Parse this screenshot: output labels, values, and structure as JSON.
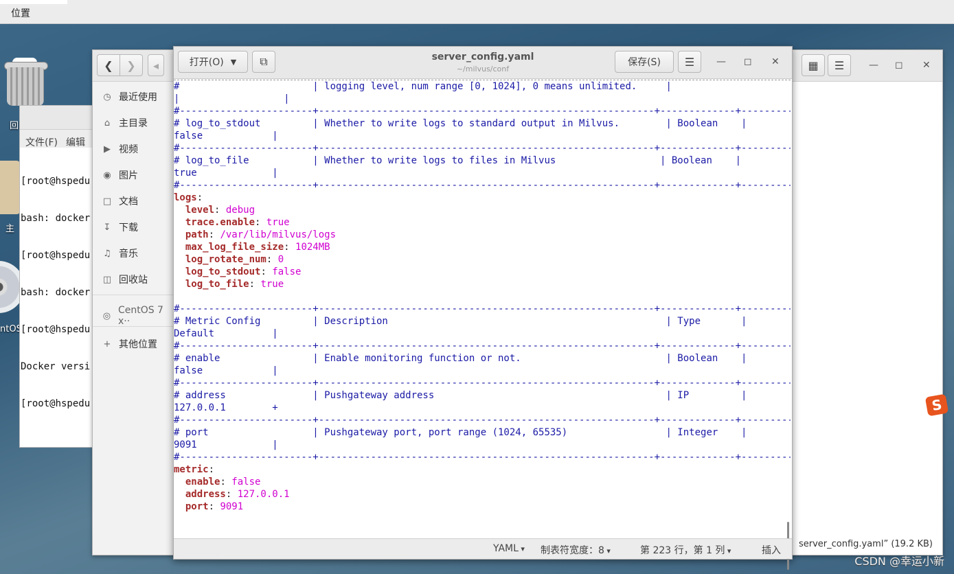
{
  "topbar": {
    "location_label": "位置"
  },
  "desktop": {
    "trash_label": "回",
    "home_label": "主",
    "disc_label": "ntOS"
  },
  "terminal": {
    "menu": [
      "文件(F)",
      "编辑"
    ],
    "lines": [
      "[root@hspedu",
      "bash: docker",
      "[root@hspedu",
      "bash: docker",
      "[root@hspedu",
      "Docker versi",
      "[root@hspedu"
    ]
  },
  "file_manager": {
    "sidebar": [
      {
        "label": "最近使用",
        "icon": "clock-icon"
      },
      {
        "label": "主目录",
        "icon": "home-icon"
      },
      {
        "label": "视频",
        "icon": "video-icon"
      },
      {
        "label": "图片",
        "icon": "camera-icon"
      },
      {
        "label": "文档",
        "icon": "document-icon"
      },
      {
        "label": "下载",
        "icon": "download-icon"
      },
      {
        "label": "音乐",
        "icon": "music-icon"
      },
      {
        "label": "回收站",
        "icon": "trash-icon"
      },
      {
        "label": "CentOS 7 x··",
        "icon": "disc-icon"
      },
      {
        "label": "其他位置",
        "icon": "plus-icon"
      }
    ],
    "status_text": "server_config.yaml”  (19.2 KB)"
  },
  "editor": {
    "open_label": "打开(O)",
    "title": "server_config.yaml",
    "subtitle": "~/milvus/conf",
    "save_label": "保存(S)",
    "status": {
      "language": "YAML",
      "tab_width": "制表符宽度：8",
      "position": "第 223 行，第 1 列",
      "mode": "插入"
    },
    "lines": [
      {
        "t": "#                       | logging level, num range [0, 1024], 0 means unlimited.     |"
      },
      {
        "t": "|                  |"
      },
      {
        "t": "#-----------------------+----------------------------------------------------------+-------------+-------------------+"
      },
      {
        "t": "# log_to_stdout         | Whether to write logs to standard output in Milvus.        | Boolean    |"
      },
      {
        "t": "false            |"
      },
      {
        "t": "#-----------------------+----------------------------------------------------------+-------------+-------------------+"
      },
      {
        "t": "# log_to_file           | Whether to write logs to files in Milvus                  | Boolean    |"
      },
      {
        "t": "true             |"
      },
      {
        "t": "#-----------------------+----------------------------------------------------------+-------------+-------------------+"
      },
      {
        "k": "logs",
        "v": ""
      },
      {
        "k": "  level",
        "v": "debug"
      },
      {
        "k": "  trace.enable",
        "v": "true"
      },
      {
        "k": "  path",
        "v": "/var/lib/milvus/logs"
      },
      {
        "k": "  max_log_file_size",
        "v": "1024MB"
      },
      {
        "k": "  log_rotate_num",
        "v": "0"
      },
      {
        "k": "  log_to_stdout",
        "v": "false"
      },
      {
        "k": "  log_to_file",
        "v": "true"
      },
      {
        "t": ""
      },
      {
        "t": "#-----------------------+----------------------------------------------------------+-------------+-------------------+"
      },
      {
        "t": "# Metric Config         | Description                                                | Type       |"
      },
      {
        "t": "Default          |"
      },
      {
        "t": "#-----------------------+----------------------------------------------------------+-------------+-------------------+"
      },
      {
        "t": "# enable                | Enable monitoring function or not.                         | Boolean    |"
      },
      {
        "t": "false            |"
      },
      {
        "t": "#-----------------------+----------------------------------------------------------+-------------+-------------------+"
      },
      {
        "t": "# address               | Pushgateway address                                        | IP         |"
      },
      {
        "t": "127.0.0.1        +"
      },
      {
        "t": "#-----------------------+----------------------------------------------------------+-------------+-------------------+"
      },
      {
        "t": "# port                  | Pushgateway port, port range (1024, 65535)                 | Integer    |"
      },
      {
        "t": "9091             |"
      },
      {
        "t": "#-----------------------+----------------------------------------------------------+-------------+-------------------+"
      },
      {
        "k": "metric",
        "v": ""
      },
      {
        "k": "  enable",
        "v": "false"
      },
      {
        "k": "  address",
        "v": "127.0.0.1"
      },
      {
        "k": "  port",
        "v": "9091"
      }
    ]
  },
  "watermark": "CSDN @幸运小新"
}
